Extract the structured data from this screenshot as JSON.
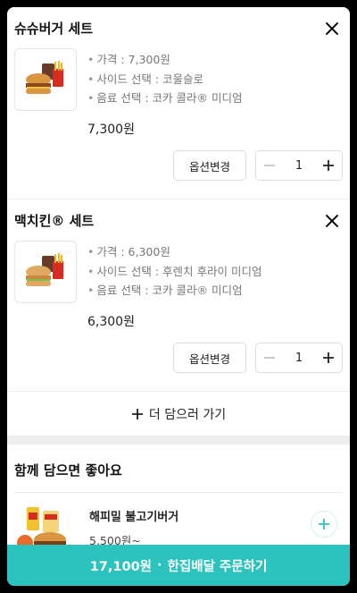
{
  "cart": {
    "items": [
      {
        "name": "슈슈버거 세트",
        "options": [
          "가격 : 7,300원",
          "사이드 선택 : 코울슬로",
          "음료 선택 : 코카 콜라® 미디엄"
        ],
        "price": "7,300원",
        "option_change_label": "옵션변경",
        "quantity": "1",
        "image_icon": "burger-set-image"
      },
      {
        "name": "맥치킨® 세트",
        "options": [
          "가격 : 6,300원",
          "사이드 선택 : 후렌치 후라이 미디엄",
          "음료 선택 : 코카 콜라® 미디엄"
        ],
        "price": "6,300원",
        "option_change_label": "옵션변경",
        "quantity": "1",
        "image_icon": "chicken-set-image"
      }
    ],
    "add_more_label": "더 담으러 가기"
  },
  "recommendations": {
    "title": "함께 담으면 좋아요",
    "items": [
      {
        "name": "해피밀 불고기버거",
        "price": "5,500원~",
        "image_icon": "happy-meal-image"
      }
    ]
  },
  "order_bar": {
    "amount": "17,100원",
    "separator": "·",
    "label": "한집배달 주문하기"
  },
  "colors": {
    "accent": "#2cc3bf",
    "text": "#222222",
    "muted": "#777777",
    "divider": "#eeeeee"
  }
}
